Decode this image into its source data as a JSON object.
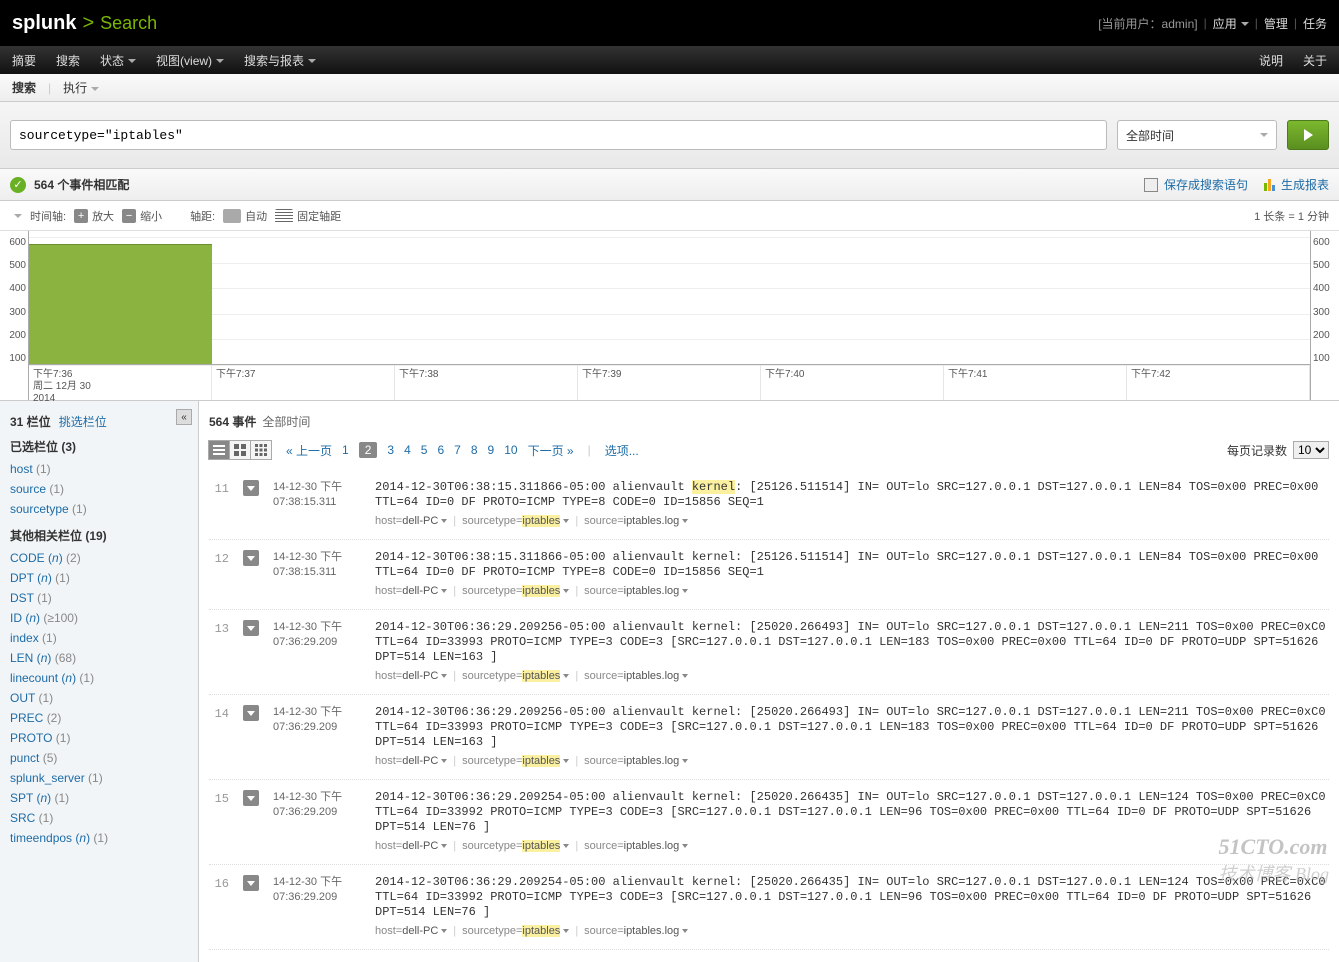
{
  "brand": {
    "logo": "splunk",
    "bracket": ">",
    "app": "Search"
  },
  "top_right": {
    "current_user": "[当前用户：admin]",
    "apps": "应用",
    "manage": "管理",
    "jobs": "任务"
  },
  "menubar": {
    "left": [
      "摘要",
      "搜索",
      "状态",
      "视图(view)",
      "搜索与报表"
    ],
    "has_caret": [
      false,
      false,
      true,
      true,
      true
    ],
    "right": [
      "说明",
      "关于"
    ]
  },
  "subbar": {
    "items": [
      "搜索",
      "执行"
    ],
    "active_index": 0
  },
  "search": {
    "query": "sourcetype=\"iptables\"",
    "time_label": "全部时间"
  },
  "status": {
    "check": "✓",
    "text": "564 个事件相匹配",
    "save": "保存成搜索语句",
    "report": "生成报表"
  },
  "timeline_ctrl": {
    "timeline_label": "时间轴:",
    "zoom_in": "放大",
    "zoom_out": "缩小",
    "axis_label": "轴距:",
    "auto": "自动",
    "fixed": "固定轴距",
    "scale_note": "1 长条 = 1 分钟"
  },
  "chart": {
    "y_ticks": [
      "600",
      "500",
      "400",
      "300",
      "200",
      "100"
    ],
    "x_ticks": [
      {
        "t": "下午7:36",
        "d": "周二 12月 30",
        "y": "2014"
      },
      {
        "t": "下午7:37"
      },
      {
        "t": "下午7:38"
      },
      {
        "t": "下午7:39"
      },
      {
        "t": "下午7:40"
      },
      {
        "t": "下午7:41"
      },
      {
        "t": "下午7:42"
      }
    ],
    "bar_value": 564,
    "y_max": 600
  },
  "chart_data": {
    "type": "bar",
    "categories": [
      "下午7:36",
      "下午7:37",
      "下午7:38",
      "下午7:39",
      "下午7:40",
      "下午7:41",
      "下午7:42"
    ],
    "values": [
      564,
      0,
      0,
      0,
      0,
      0,
      0
    ],
    "ylabel": "",
    "ylim": [
      0,
      600
    ]
  },
  "sidebar": {
    "title": "31 栏位",
    "select_link": "挑选栏位",
    "selected_label": "已选栏位 (3)",
    "selected": [
      {
        "name": "host",
        "count": "(1)"
      },
      {
        "name": "source",
        "count": "(1)"
      },
      {
        "name": "sourcetype",
        "count": "(1)"
      }
    ],
    "other_label": "其他相关栏位 (19)",
    "other": [
      {
        "name": "CODE",
        "n": true,
        "count": "(2)"
      },
      {
        "name": "DPT",
        "n": true,
        "count": "(1)"
      },
      {
        "name": "DST",
        "n": false,
        "count": "(1)"
      },
      {
        "name": "ID",
        "n": true,
        "count": "(≥100)"
      },
      {
        "name": "index",
        "n": false,
        "count": "(1)"
      },
      {
        "name": "LEN",
        "n": true,
        "count": "(68)"
      },
      {
        "name": "linecount",
        "n": true,
        "count": "(1)"
      },
      {
        "name": "OUT",
        "n": false,
        "count": "(1)"
      },
      {
        "name": "PREC",
        "n": false,
        "count": "(2)"
      },
      {
        "name": "PROTO",
        "n": false,
        "count": "(1)"
      },
      {
        "name": "punct",
        "n": false,
        "count": "(5)"
      },
      {
        "name": "splunk_server",
        "n": false,
        "count": "(1)"
      },
      {
        "name": "SPT",
        "n": true,
        "count": "(1)"
      },
      {
        "name": "SRC",
        "n": false,
        "count": "(1)"
      },
      {
        "name": "timeendpos",
        "n": true,
        "count": "(1)"
      }
    ]
  },
  "content": {
    "count_label": "564 事件",
    "range_label": "全部时间",
    "pager": {
      "prev": "« 上一页",
      "pages": [
        "1",
        "2",
        "3",
        "4",
        "5",
        "6",
        "7",
        "8",
        "9",
        "10"
      ],
      "current": "2",
      "next": "下一页 »",
      "options": "选项..."
    },
    "per_page": {
      "label": "每页记录数",
      "value": "10"
    },
    "meta_labels": {
      "host": "host",
      "sourcetype": "sourcetype",
      "source": "source"
    },
    "events": [
      {
        "n": "11",
        "date": "14-12-30 下午",
        "time": "07:38:15.311",
        "raw_prefix": "2014-12-30T06:38:15.311866-05:00 alienvault ",
        "hl": "kernel",
        "raw_suffix": ": [25126.511514] IN= OUT=lo SRC=127.0.0.1 DST=127.0.0.1 LEN=84 TOS=0x00 PREC=0x00 TTL=64 ID=0 DF PROTO=ICMP TYPE=8 CODE=0 ID=15856 SEQ=1",
        "host": "dell-PC",
        "sourcetype": "iptables",
        "source": "iptables.log"
      },
      {
        "n": "12",
        "date": "14-12-30 下午",
        "time": "07:38:15.311",
        "raw": "2014-12-30T06:38:15.311866-05:00 alienvault kernel: [25126.511514] IN= OUT=lo SRC=127.0.0.1 DST=127.0.0.1 LEN=84 TOS=0x00 PREC=0x00 TTL=64 ID=0 DF PROTO=ICMP TYPE=8 CODE=0 ID=15856 SEQ=1",
        "host": "dell-PC",
        "sourcetype": "iptables",
        "source": "iptables.log"
      },
      {
        "n": "13",
        "date": "14-12-30 下午",
        "time": "07:36:29.209",
        "raw": "2014-12-30T06:36:29.209256-05:00 alienvault kernel: [25020.266493] IN= OUT=lo SRC=127.0.0.1 DST=127.0.0.1 LEN=211 TOS=0x00 PREC=0xC0 TTL=64 ID=33993 PROTO=ICMP TYPE=3 CODE=3 [SRC=127.0.0.1 DST=127.0.0.1 LEN=183 TOS=0x00 PREC=0x00 TTL=64 ID=0 DF PROTO=UDP SPT=51626 DPT=514 LEN=163 ]",
        "host": "dell-PC",
        "sourcetype": "iptables",
        "source": "iptables.log"
      },
      {
        "n": "14",
        "date": "14-12-30 下午",
        "time": "07:36:29.209",
        "raw": "2014-12-30T06:36:29.209256-05:00 alienvault kernel: [25020.266493] IN= OUT=lo SRC=127.0.0.1 DST=127.0.0.1 LEN=211 TOS=0x00 PREC=0xC0 TTL=64 ID=33993 PROTO=ICMP TYPE=3 CODE=3 [SRC=127.0.0.1 DST=127.0.0.1 LEN=183 TOS=0x00 PREC=0x00 TTL=64 ID=0 DF PROTO=UDP SPT=51626 DPT=514 LEN=163 ]",
        "host": "dell-PC",
        "sourcetype": "iptables",
        "source": "iptables.log"
      },
      {
        "n": "15",
        "date": "14-12-30 下午",
        "time": "07:36:29.209",
        "raw": "2014-12-30T06:36:29.209254-05:00 alienvault kernel: [25020.266435] IN= OUT=lo SRC=127.0.0.1 DST=127.0.0.1 LEN=124 TOS=0x00 PREC=0xC0 TTL=64 ID=33992 PROTO=ICMP TYPE=3 CODE=3 [SRC=127.0.0.1 DST=127.0.0.1 LEN=96 TOS=0x00 PREC=0x00 TTL=64 ID=0 DF PROTO=UDP SPT=51626 DPT=514 LEN=76 ]",
        "host": "dell-PC",
        "sourcetype": "iptables",
        "source": "iptables.log"
      },
      {
        "n": "16",
        "date": "14-12-30 下午",
        "time": "07:36:29.209",
        "raw": "2014-12-30T06:36:29.209254-05:00 alienvault kernel: [25020.266435] IN= OUT=lo SRC=127.0.0.1 DST=127.0.0.1 LEN=124 TOS=0x00 PREC=0xC0 TTL=64 ID=33992 PROTO=ICMP TYPE=3 CODE=3 [SRC=127.0.0.1 DST=127.0.0.1 LEN=96 TOS=0x00 PREC=0x00 TTL=64 ID=0 DF PROTO=UDP SPT=51626 DPT=514 LEN=76 ]",
        "host": "dell-PC",
        "sourcetype": "iptables",
        "source": "iptables.log"
      }
    ]
  },
  "watermark": {
    "line1": "51CTO.com",
    "line2": "技术博客 Blog"
  }
}
